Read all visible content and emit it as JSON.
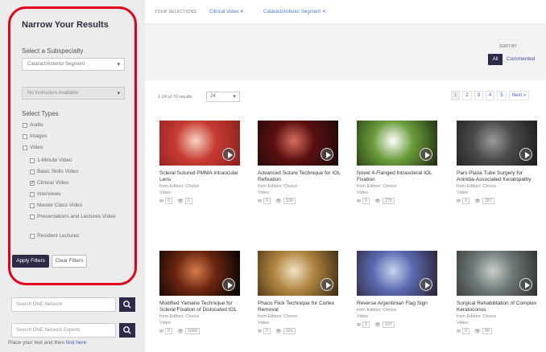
{
  "sidebar": {
    "title": "Narrow Your Results",
    "subspecialty_label": "Select a Subspecialty",
    "subspecialty_value": "Cataract/Anterior Segment",
    "instructor_value": "No Instructors Available",
    "types_label": "Select Types",
    "types": [
      {
        "label": "Audio",
        "checked": false
      },
      {
        "label": "Images",
        "checked": false
      },
      {
        "label": "Video",
        "checked": false
      }
    ],
    "video_types": [
      {
        "label": "1-Minute Video",
        "checked": false
      },
      {
        "label": "Basic Skills Video",
        "checked": false
      },
      {
        "label": "Clinical Video",
        "checked": true
      },
      {
        "label": "Interviews",
        "checked": false
      },
      {
        "label": "Master Class Video",
        "checked": false
      },
      {
        "label": "Presentations and Lectures Video",
        "checked": false
      },
      {
        "label": "Resident Lectures",
        "checked": false
      }
    ],
    "apply_label": "Apply Filters",
    "clear_label": "Clear Filters",
    "search1_placeholder": "Search ONE Network",
    "search2_placeholder": "Search ONE Network Experts",
    "note_text": "Place your text and then ",
    "note_link": "find here"
  },
  "topbar": {
    "selections_label": "YOUR SELECTIONS:",
    "chips": [
      "Clinical Video ✕",
      "Cataract/Anterior Segment ✕"
    ]
  },
  "sort": {
    "label": "SORT BY",
    "all": "All",
    "commented": "Commented"
  },
  "results": {
    "count_text": "1-24 of 70 results",
    "per_page": "24",
    "pages": [
      "1",
      "2",
      "3",
      "4",
      "5",
      "Next »"
    ]
  },
  "cards": [
    {
      "title": "Scleral Sutured PMMA Intraocular Lens",
      "author": "from Editors' Choice",
      "type": "Video",
      "likes": "0",
      "views": "0",
      "thumb": [
        "#f6d2c2",
        "#c73b33",
        "#8a1f1f"
      ]
    },
    {
      "title": "Advanced Suture Technique for IOL Refixation",
      "author": "from Editors' Choice",
      "type": "Video",
      "likes": "0",
      "views": "100",
      "thumb": [
        "#d76e5e",
        "#5a0f10",
        "#1c0a0a"
      ]
    },
    {
      "title": "Novel 4-Flanged Intrascleral IOL Fixation",
      "author": "from Editors' Choice",
      "type": "Video",
      "likes": "0",
      "views": "270",
      "thumb": [
        "#ffffff",
        "#6a9b3a",
        "#1e2c0f"
      ]
    },
    {
      "title": "Pars Plana Tube Surgery for Aniridia-Associated Keratopathy",
      "author": "from Editors' Choice",
      "type": "Video",
      "likes": "0",
      "views": "187",
      "thumb": [
        "#9a9a9a",
        "#4a4a4a",
        "#1a1a1a"
      ]
    },
    {
      "title": "Modified Yamane Technique for Scleral Fixation of Dislocated IOL",
      "author": "from Editors' Choice",
      "type": "Video",
      "likes": "0",
      "views": "1090",
      "thumb": [
        "#d77a4a",
        "#6a2510",
        "#000000"
      ]
    },
    {
      "title": "Phaco Flick Technique for Cortex Removal",
      "author": "from Editors' Choice",
      "type": "Video",
      "likes": "0",
      "views": "101",
      "thumb": [
        "#f0e2c4",
        "#b08440",
        "#3a2a10"
      ]
    },
    {
      "title": "Reverse Argentinian Flag Sign",
      "author": "from Editors' Choice",
      "type": "Video",
      "likes": "0",
      "views": "107",
      "thumb": [
        "#c8d4f0",
        "#5a6ab0",
        "#2a2030"
      ]
    },
    {
      "title": "Surgical Rehabilitation of Complex Keratoconus",
      "author": "from Editors' Choice",
      "type": "Video",
      "likes": "0",
      "views": "90",
      "thumb": [
        "#c8d0c8",
        "#70787a",
        "#2a302a"
      ]
    }
  ],
  "colors": {
    "highlight": "#e3001b",
    "primary_button": "#2c2c4a",
    "link": "#3f5fb0"
  }
}
